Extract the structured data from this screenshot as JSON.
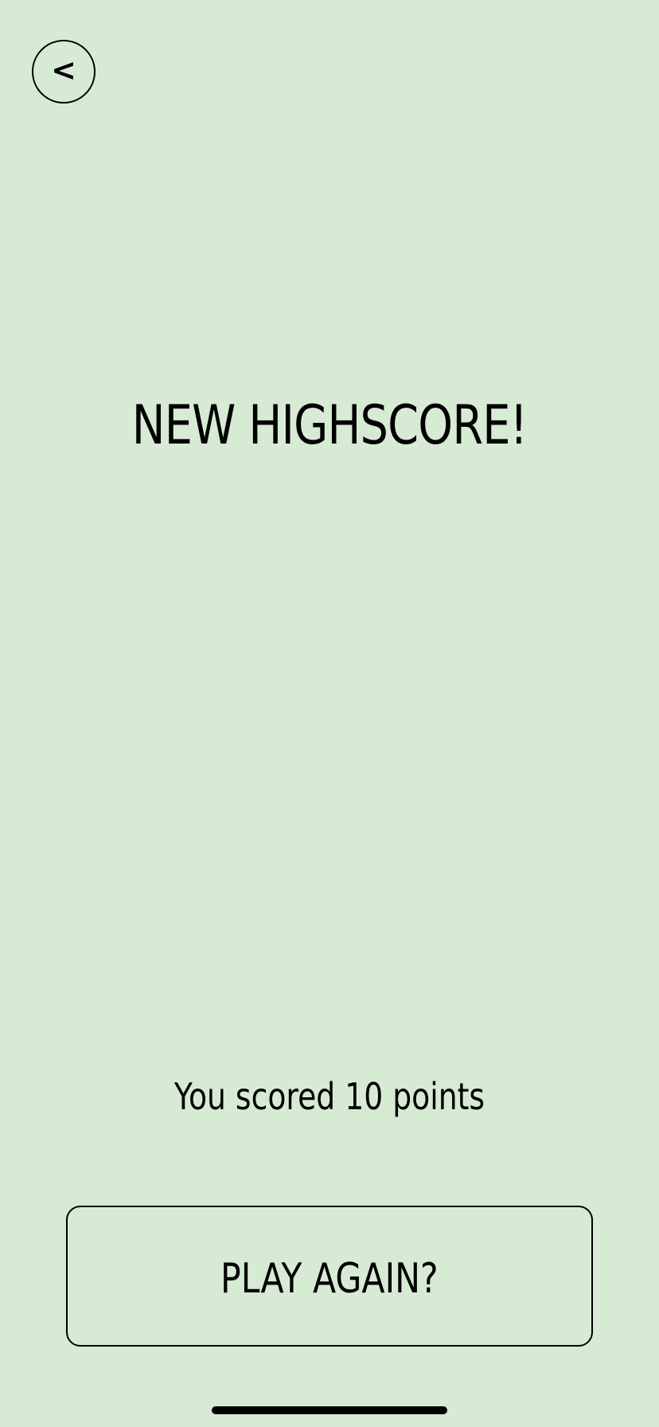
{
  "nav": {
    "back_label": "<"
  },
  "result": {
    "headline": "NEW HIGHSCORE!",
    "score_text": "You scored 10 points"
  },
  "actions": {
    "play_again_label": "PLAY AGAIN?"
  },
  "theme": {
    "background": "#d7ebd4",
    "foreground": "#000000"
  }
}
